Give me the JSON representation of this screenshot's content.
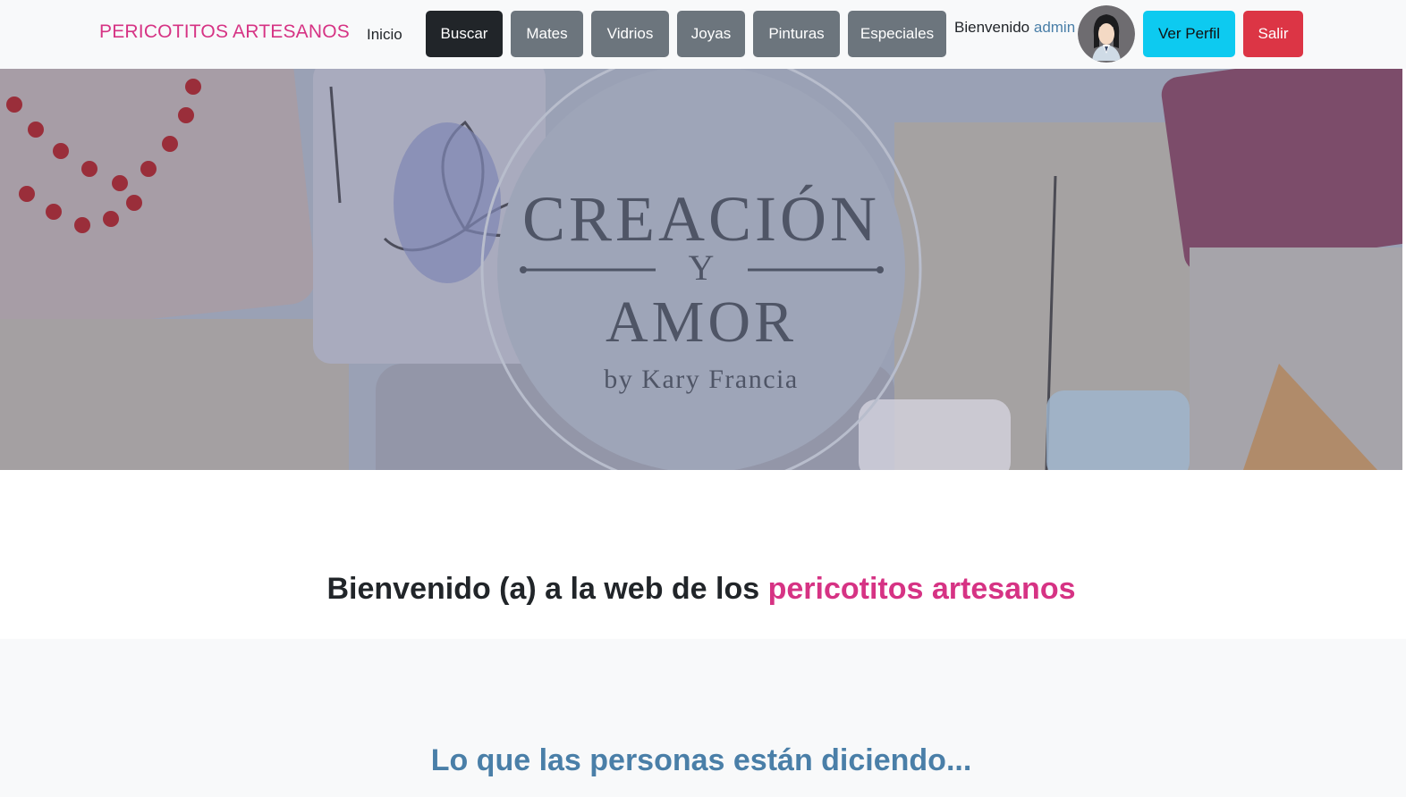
{
  "navbar": {
    "brand": "PERICOTITOS ARTESANOS",
    "home_link": "Inicio",
    "buttons": {
      "buscar": "Buscar",
      "mates": "Mates",
      "vidrios": "Vidrios",
      "joyas": "Joyas",
      "pinturas": "Pinturas",
      "especiales": "Especiales"
    },
    "welcome_prefix": "Bienvenido",
    "username": "admin",
    "profile_button": "Ver Perfil",
    "logout_button": "Salir"
  },
  "hero": {
    "logo_line1": "CREACIÓN",
    "logo_line2": "Y",
    "logo_line3": "AMOR",
    "logo_byline": "by Kary Francia"
  },
  "welcome_section": {
    "heading_prefix": "Bienvenido (a) a la web de los",
    "heading_highlight": "pericotitos artesanos"
  },
  "testimonials": {
    "heading": "Lo que las personas están diciendo..."
  },
  "colors": {
    "brand_pink": "#d63384",
    "dark": "#212529",
    "secondary": "#6c757d",
    "info": "#0dcaf0",
    "danger": "#dc3545",
    "accent_blue": "#4a7fa8"
  },
  "icons": {
    "avatar": "user-avatar-icon"
  }
}
